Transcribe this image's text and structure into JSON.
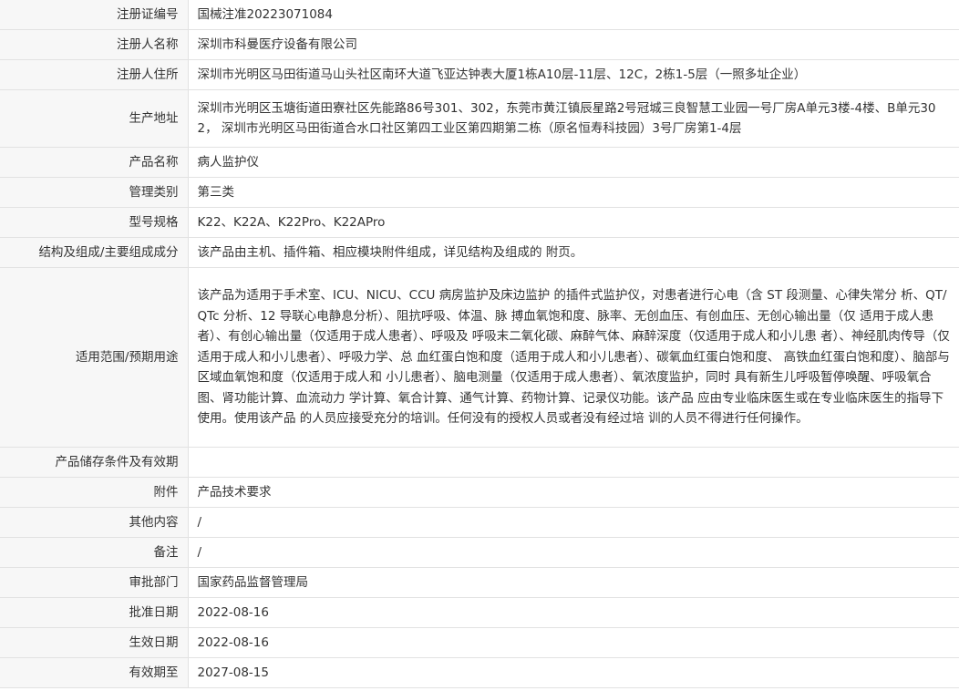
{
  "rows": [
    {
      "label": "注册证编号",
      "value": "国械注准20223071084"
    },
    {
      "label": "注册人名称",
      "value": "深圳市科曼医疗设备有限公司"
    },
    {
      "label": "注册人住所",
      "value": "深圳市光明区马田街道马山头社区南环大道飞亚达钟表大厦1栋A10层-11层、12C，2栋1-5层（一照多址企业）"
    },
    {
      "label": "生产地址",
      "value": "深圳市光明区玉塘街道田寮社区先能路86号301、302，东莞市黄江镇辰星路2号冠城三良智慧工业园一号厂房A单元3楼-4楼、B单元302， 深圳市光明区马田街道合水口社区第四工业区第四期第二栋（原名恒寿科技园）3号厂房第1-4层"
    },
    {
      "label": "产品名称",
      "value": "病人监护仪"
    },
    {
      "label": "管理类别",
      "value": "第三类"
    },
    {
      "label": "型号规格",
      "value": "K22、K22A、K22Pro、K22APro"
    },
    {
      "label": "结构及组成/主要组成成分",
      "value": "该产品由主机、插件箱、相应模块附件组成，详见结构及组成的 附页。"
    },
    {
      "label": "适用范围/预期用途",
      "value": "该产品为适用于手术室、ICU、NICU、CCU 病房监护及床边监护 的插件式监护仪，对患者进行心电（含 ST 段测量、心律失常分 析、QT/QTc 分析、12 导联心电静息分析）、阻抗呼吸、体温、脉 搏血氧饱和度、脉率、无创血压、有创血压、无创心输出量（仅 适用于成人患者）、有创心输出量（仅适用于成人患者）、呼吸及 呼吸末二氧化碳、麻醉气体、麻醉深度（仅适用于成人和小儿患 者）、神经肌肉传导（仅适用于成人和小儿患者）、呼吸力学、总 血红蛋白饱和度（适用于成人和小儿患者）、碳氧血红蛋白饱和度、 高铁血红蛋白饱和度）、脑部与区域血氧饱和度（仅适用于成人和 小儿患者）、脑电测量（仅适用于成人患者）、氧浓度监护，同时 具有新生儿呼吸暂停唤醒、呼吸氧合图、肾功能计算、血流动力 学计算、氧合计算、通气计算、药物计算、记录仪功能。该产品 应由专业临床医生或在专业临床医生的指导下使用。使用该产品 的人员应接受充分的培训。任何没有的授权人员或者没有经过培 训的人员不得进行任何操作。"
    },
    {
      "label": "产品储存条件及有效期",
      "value": ""
    },
    {
      "label": "附件",
      "value": "产品技术要求"
    },
    {
      "label": "其他内容",
      "value": "/"
    },
    {
      "label": "备注",
      "value": "/"
    },
    {
      "label": "审批部门",
      "value": "国家药品监督管理局"
    },
    {
      "label": "批准日期",
      "value": "2022-08-16"
    },
    {
      "label": "生效日期",
      "value": "2022-08-16"
    },
    {
      "label": "有效期至",
      "value": "2027-08-15"
    }
  ]
}
